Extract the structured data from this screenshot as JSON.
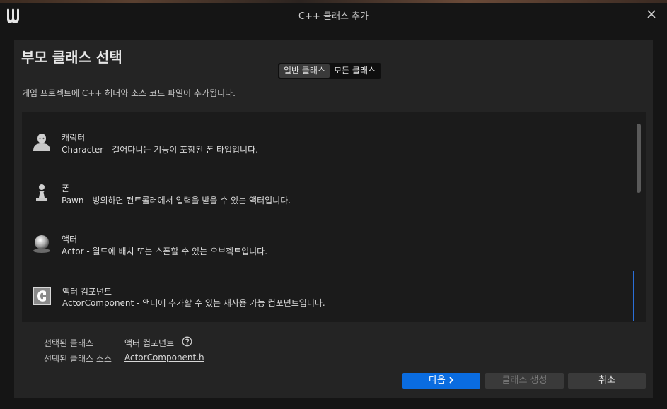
{
  "window": {
    "title": "C++ 클래스 추가"
  },
  "panel": {
    "heading": "부모 클래스 선택",
    "tabs": [
      {
        "label": "일반 클래스",
        "active": true
      },
      {
        "label": "모든 클래스",
        "active": false
      }
    ],
    "description": "게임 프로젝트에 C++ 헤더와 소스 코드 파일이 추가됩니다."
  },
  "classes": [
    {
      "name": "캐릭터",
      "description": "Character - 걸어다니는 기능이 포함된 폰 타입입니다.",
      "icon": "character-icon"
    },
    {
      "name": "폰",
      "description": "Pawn - 빙의하면 컨트롤러에서 입력을 받을 수 있는 액터입니다.",
      "icon": "pawn-icon"
    },
    {
      "name": "액터",
      "description": "Actor - 월드에 배치 또는 스폰할 수 있는 오브젝트입니다.",
      "icon": "actor-icon"
    },
    {
      "name": "액터 컴포넌트",
      "description": "ActorComponent - 액터에 추가할 수 있는 재사용 가능 컴포넌트입니다.",
      "icon": "actor-component-icon",
      "selected": true
    }
  ],
  "selection": {
    "class_label": "선택된 클래스",
    "class_value": "액터 컴포넌트",
    "source_label": "선택된 클래스 소스",
    "source_value": "ActorComponent.h"
  },
  "buttons": {
    "next": "다음",
    "create": "클래스 생성",
    "cancel": "취소"
  },
  "colors": {
    "accent": "#0a6ce0",
    "selection_border": "#2b6fd8"
  }
}
